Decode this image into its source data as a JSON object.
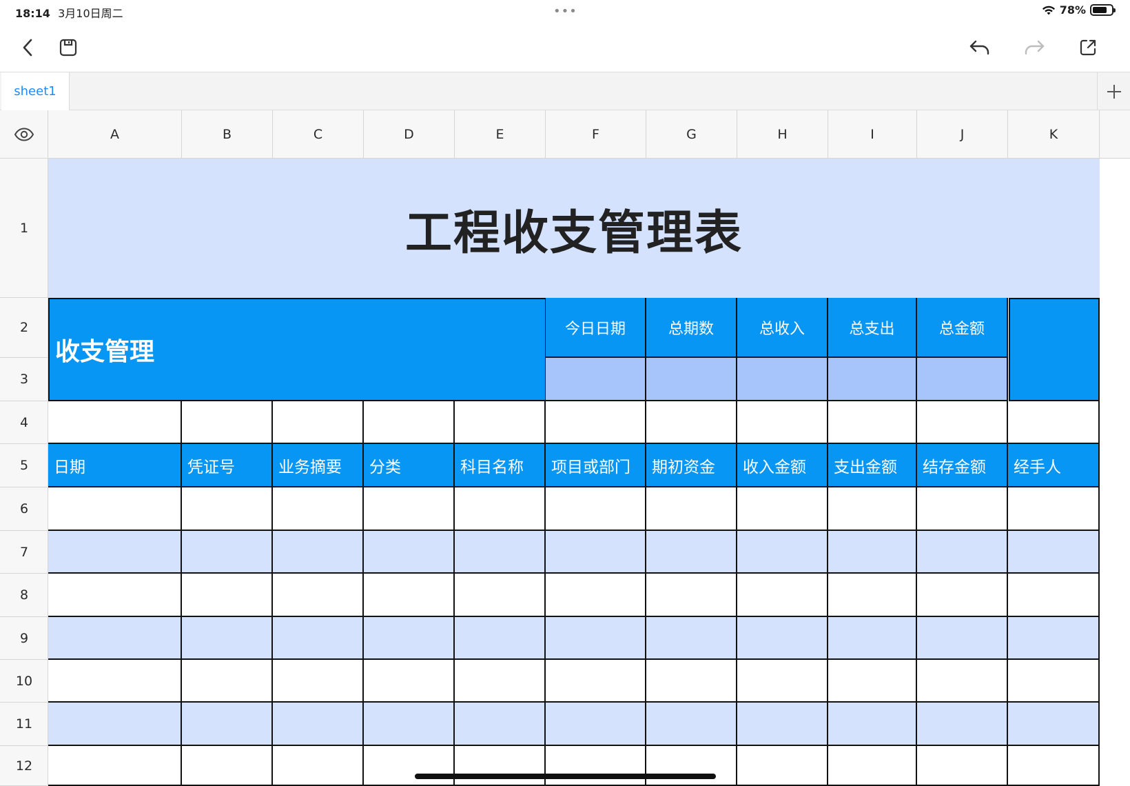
{
  "status": {
    "time": "18:14",
    "date": "3月10日周二",
    "battery_pct": "78%",
    "battery_level": 0.78,
    "dots": "•••"
  },
  "toolbar": {
    "back_icon": "chevron-left-icon",
    "save_icon": "save-icon",
    "undo_icon": "undo-icon",
    "redo_icon": "redo-icon",
    "share_icon": "share-icon"
  },
  "tabs": {
    "active": "sheet1",
    "add_label": "+"
  },
  "columns": [
    "A",
    "B",
    "C",
    "D",
    "E",
    "F",
    "G",
    "H",
    "I",
    "J",
    "K"
  ],
  "rows": [
    "1",
    "2",
    "3",
    "4",
    "5",
    "6",
    "7",
    "8",
    "9",
    "10",
    "11",
    "12"
  ],
  "sheet": {
    "title": "工程收支管理表",
    "section": "收支管理",
    "summary_headers": [
      "今日日期",
      "总期数",
      "总收入",
      "总支出",
      "总金额"
    ],
    "table_headers": [
      "日期",
      "凭证号",
      "业务摘要",
      "分类",
      "科目名称",
      "项目或部门",
      "期初资金",
      "收入金额",
      "支出金额",
      "结存金额",
      "经手人"
    ]
  },
  "colors": {
    "accent_blue": "#0896f5",
    "light_blue": "#d4e2fd",
    "mid_blue": "#a7c4fb",
    "tab_active": "#1a8cff"
  }
}
